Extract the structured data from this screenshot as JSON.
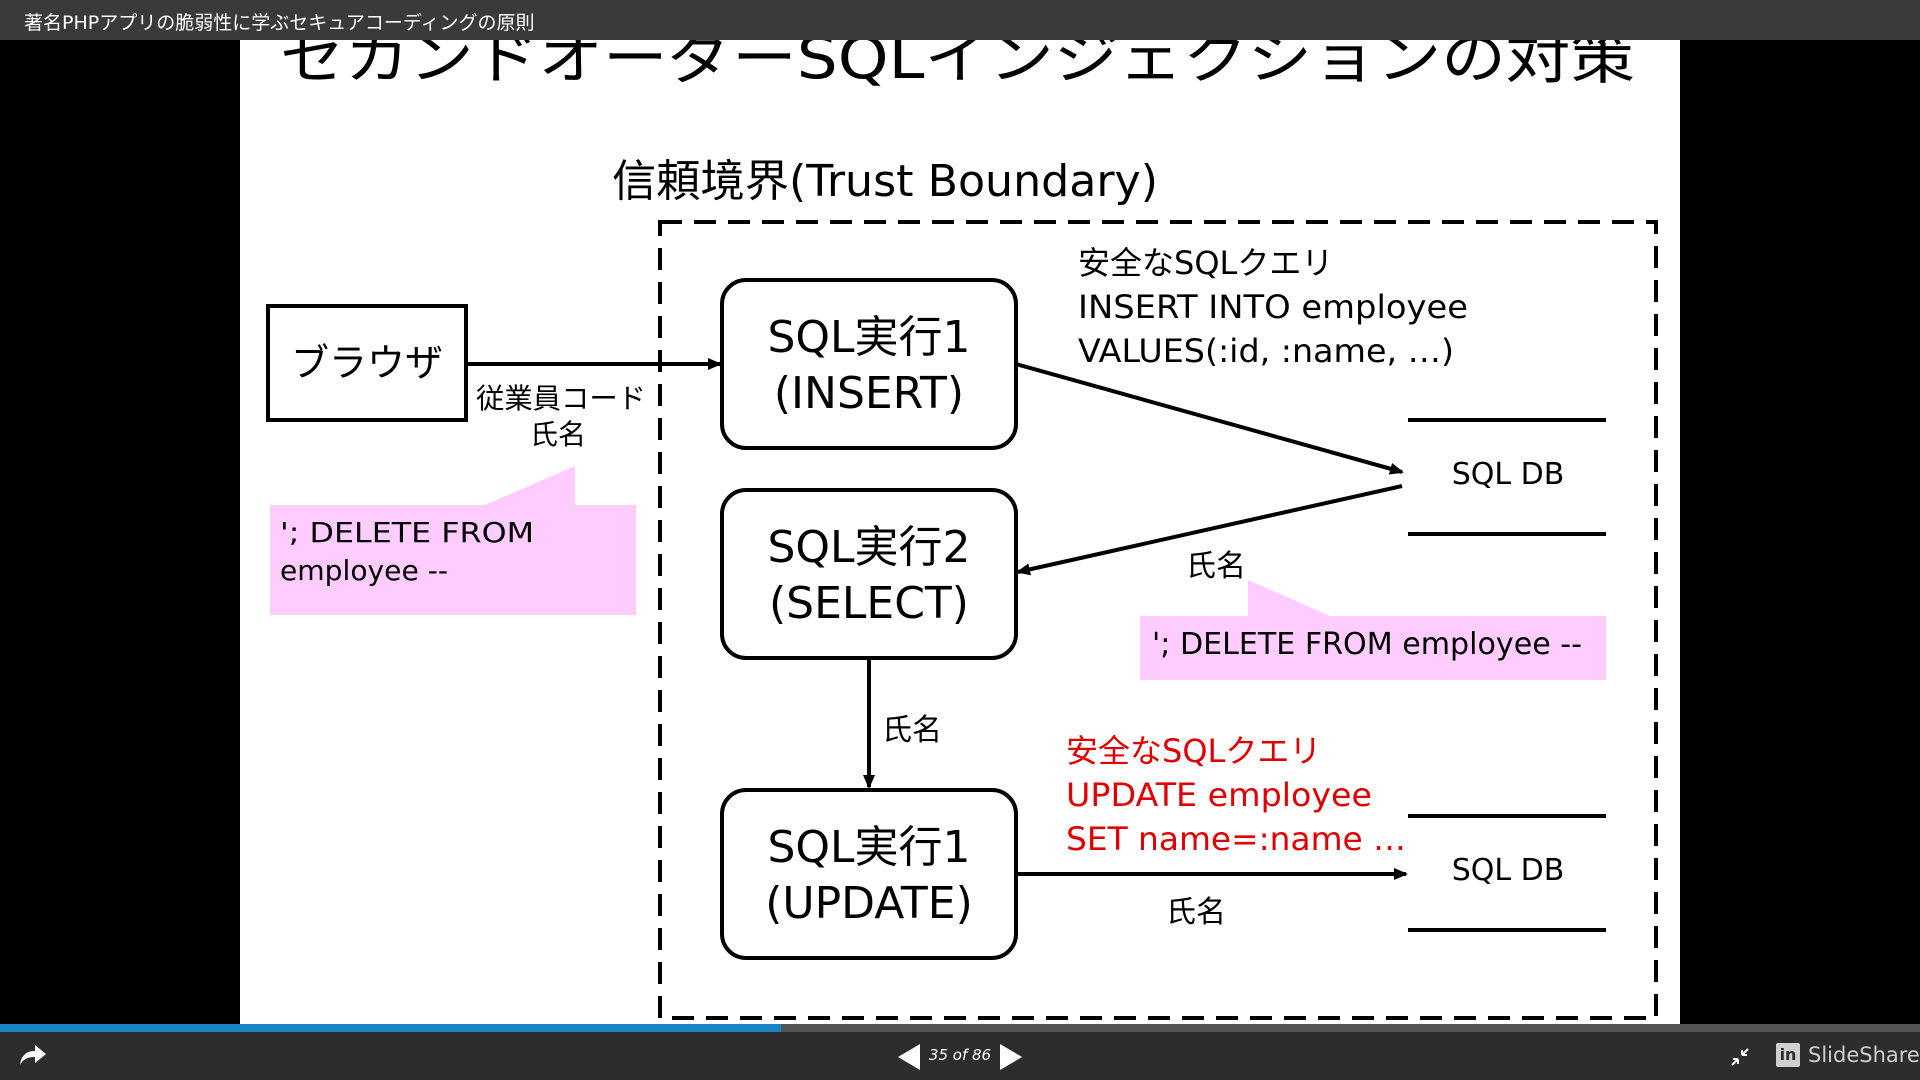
{
  "presentation": {
    "title": "著名PHPアプリの脆弱性に学ぶセキュアコーディングの原則"
  },
  "slide": {
    "heading": "セカンドオーダーSQLインジェクションの対策",
    "boundary_label": "信頼境界(Trust Boundary)",
    "browser_label": "ブラウザ",
    "step1": {
      "line1": "SQL実行1",
      "line2": "(INSERT)"
    },
    "step2": {
      "line1": "SQL実行2",
      "line2": "(SELECT)"
    },
    "step3": {
      "line1": "SQL実行1",
      "line2": "(UPDATE)"
    },
    "input_label": {
      "line1": "従業員コード",
      "line2": "氏名"
    },
    "payload1": {
      "line1": "'; DELETE FROM",
      "line2": "employee --"
    },
    "payload2": "'; DELETE FROM employee --",
    "safe_query1": {
      "line1": "安全なSQLクエリ",
      "line2": "INSERT INTO employee",
      "line3": "VALUES(:id, :name, …)"
    },
    "safe_query2": {
      "line1": "安全なSQLクエリ",
      "line2": "UPDATE employee",
      "line3": "SET name=:name …"
    },
    "db_label_top": "SQL DB",
    "db_label_bottom": "SQL DB",
    "name_label_select": "氏名",
    "name_label_down": "氏名",
    "name_label_update": "氏名",
    "colors": {
      "callout_bg": "#ffccff",
      "safe_query2_text": "#e00000"
    }
  },
  "player": {
    "page_indicator": "35 of 86",
    "current_page": 35,
    "total_pages": 86,
    "brand": "SlideShare",
    "brand_icon": "linkedin-icon",
    "progress": 0.407,
    "share_icon": "share-arrow-icon",
    "prev_icon": "prev-triangle-icon",
    "next_icon": "next-triangle-icon",
    "fullscreen_icon": "collapse-icon"
  }
}
